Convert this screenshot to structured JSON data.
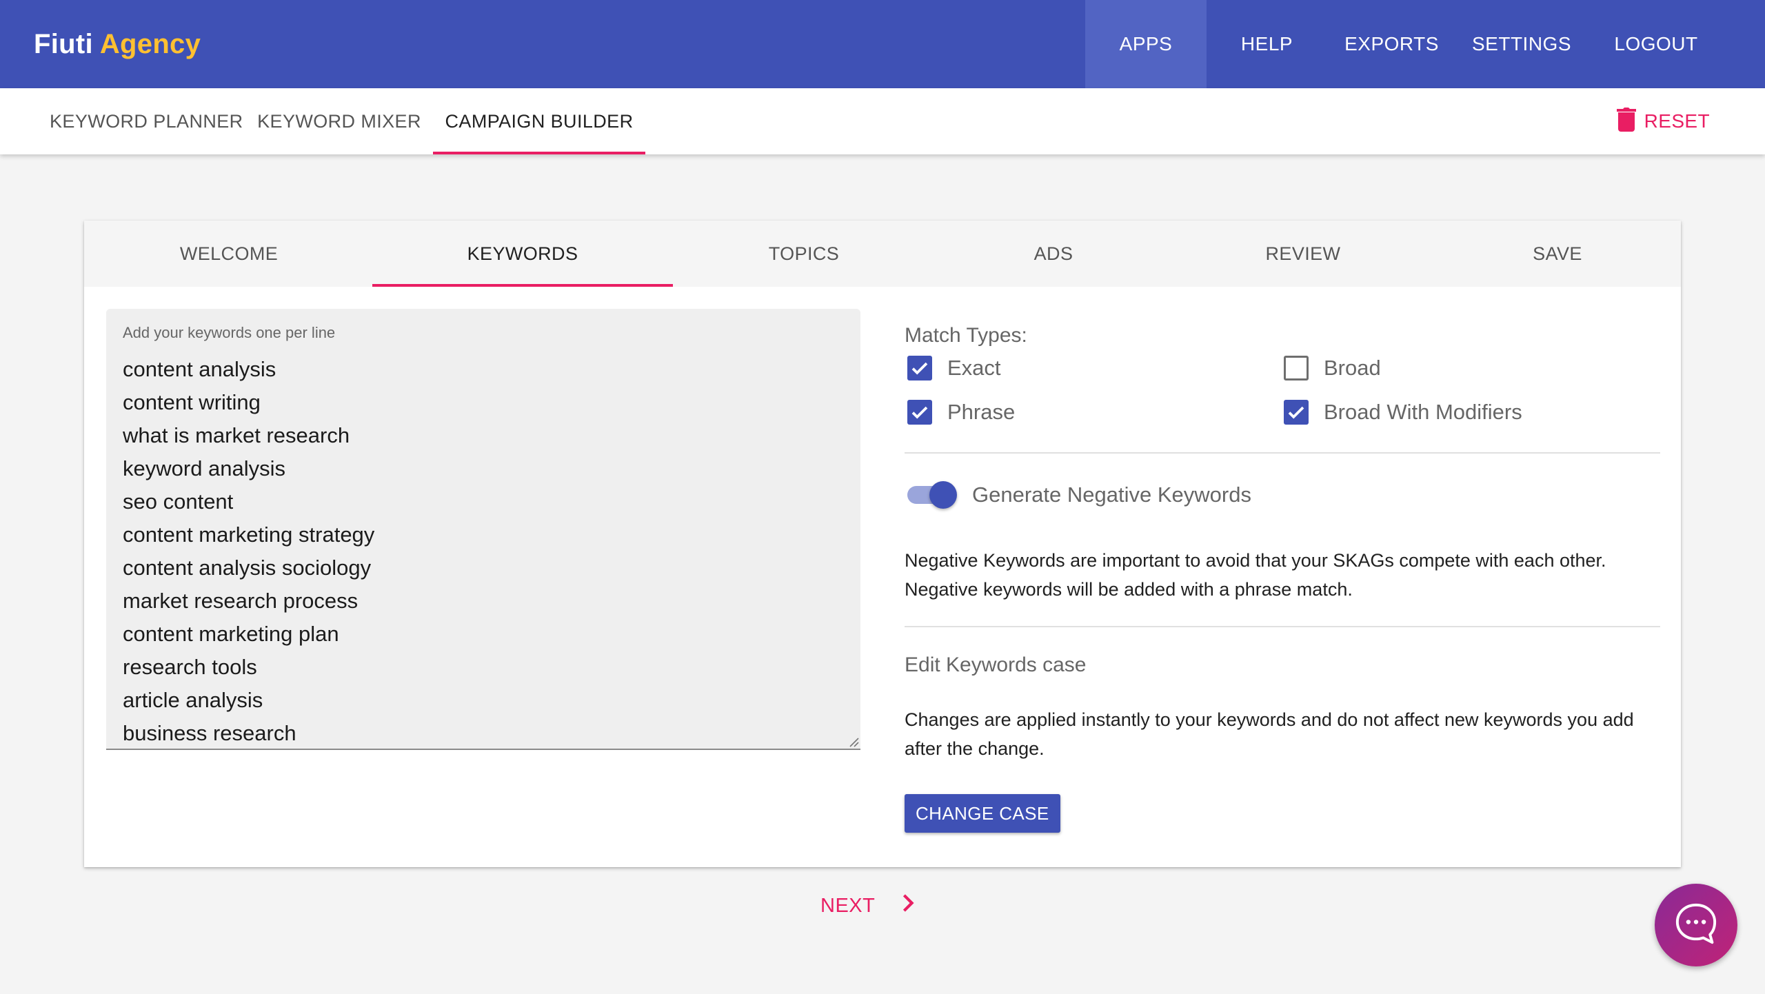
{
  "brand": {
    "name": "Fiuti",
    "accent": "Agency"
  },
  "topnav": {
    "apps": "APPS",
    "help": "HELP",
    "exports": "EXPORTS",
    "settings": "SETTINGS",
    "logout": "LOGOUT"
  },
  "subtabs": {
    "planner": "KEYWORD PLANNER",
    "mixer": "KEYWORD MIXER",
    "builder": "CAMPAIGN BUILDER",
    "reset": "RESET"
  },
  "steps": {
    "welcome": "WELCOME",
    "keywords": "KEYWORDS",
    "topics": "TOPICS",
    "ads": "ADS",
    "review": "REVIEW",
    "save": "SAVE"
  },
  "keywords": {
    "label": "Add your keywords one per line",
    "lines": [
      "content analysis",
      "content writing",
      "what is market research",
      "keyword analysis",
      "seo content",
      "content marketing strategy",
      "content analysis sociology",
      "market research process",
      "content marketing plan",
      "research tools",
      "article analysis",
      "business research"
    ]
  },
  "match_types": {
    "title": "Match Types:",
    "exact": "Exact",
    "broad": "Broad",
    "phrase": "Phrase",
    "broad_modifiers": "Broad With Modifiers"
  },
  "negative": {
    "toggle_label": "Generate Negative Keywords",
    "description": "Negative Keywords are important to avoid that your SKAGs compete with each other. Negative keywords will be added with a phrase match."
  },
  "case": {
    "title": "Edit Keywords case",
    "description": "Changes are applied instantly to your keywords and do not affect new keywords you add after the change.",
    "button": "CHANGE CASE"
  },
  "footer": {
    "next": "NEXT"
  },
  "colors": {
    "primary": "#3f51b5",
    "accent": "#e91e63",
    "brand_accent": "#ffc031"
  }
}
